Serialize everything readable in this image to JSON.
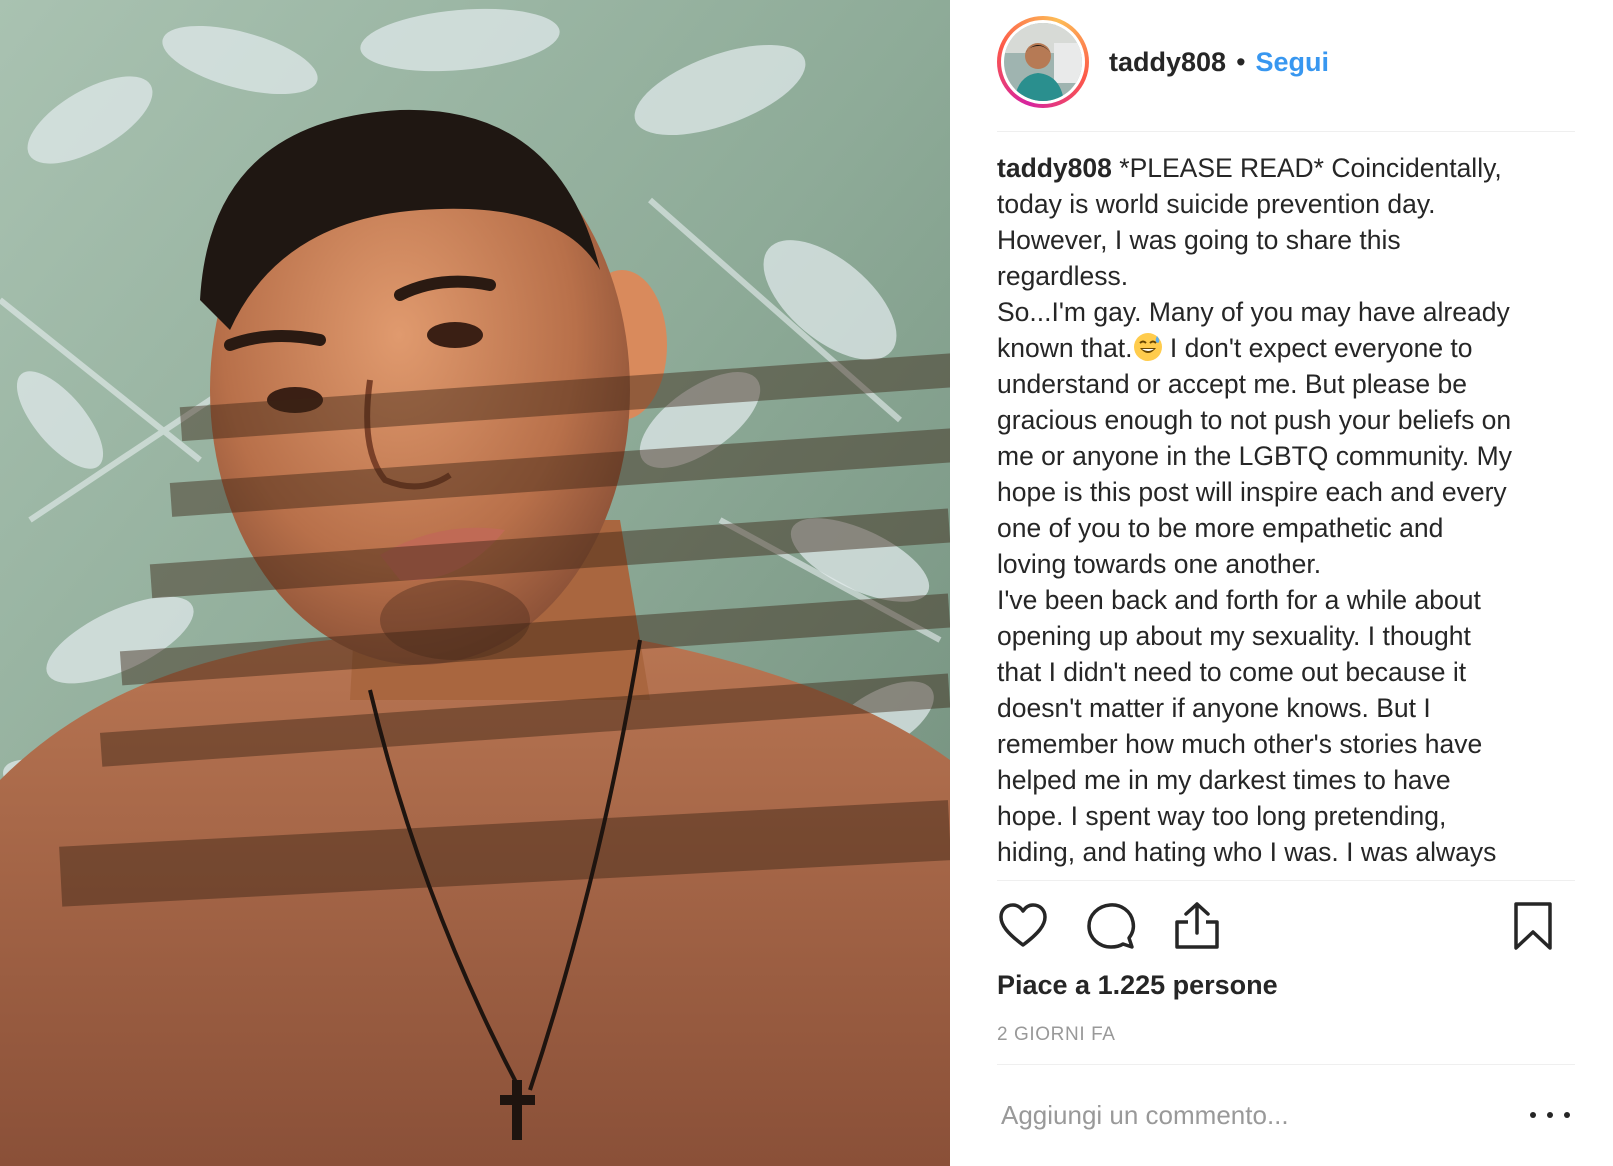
{
  "post": {
    "username": "taddy808",
    "separator": "•",
    "follow_label": "Segui",
    "caption_lines": [
      "*PLEASE READ* Coincidentally,",
      "today is world suicide prevention day.",
      "However, I was going to share this",
      "regardless.",
      "So...I'm gay. Many of you may have already",
      "known that.",
      " I don't expect everyone to",
      "understand or accept me. But please be",
      "gracious enough to not push your beliefs on",
      "me or anyone in the LGBTQ community. My",
      "hope is this post will inspire each and every",
      "one of you to be more empathetic and",
      "loving towards one another.",
      "I've been back and forth for a while about",
      "opening up about my sexuality. I thought",
      "that I didn't need to come out because it",
      "doesn't matter if anyone knows. But I",
      "remember how much other's stories have",
      "helped me in my darkest times to have",
      "hope. I spent way too long pretending,",
      "hiding, and hating who I was. I was always"
    ],
    "likes_text": "Piace a 1.225 persone",
    "time_text": "2 GIORNI FA",
    "comment_placeholder": "Aggiungi un commento...",
    "icons": {
      "like": "heart-icon",
      "comment": "comment-bubble-icon",
      "share": "share-upload-icon",
      "save": "bookmark-icon",
      "more": "more-options-icon",
      "emoji": "sweat-smile-emoji"
    },
    "colors": {
      "text": "#262626",
      "link": "#3897f0",
      "muted": "#999999",
      "divider": "#efefef"
    }
  }
}
